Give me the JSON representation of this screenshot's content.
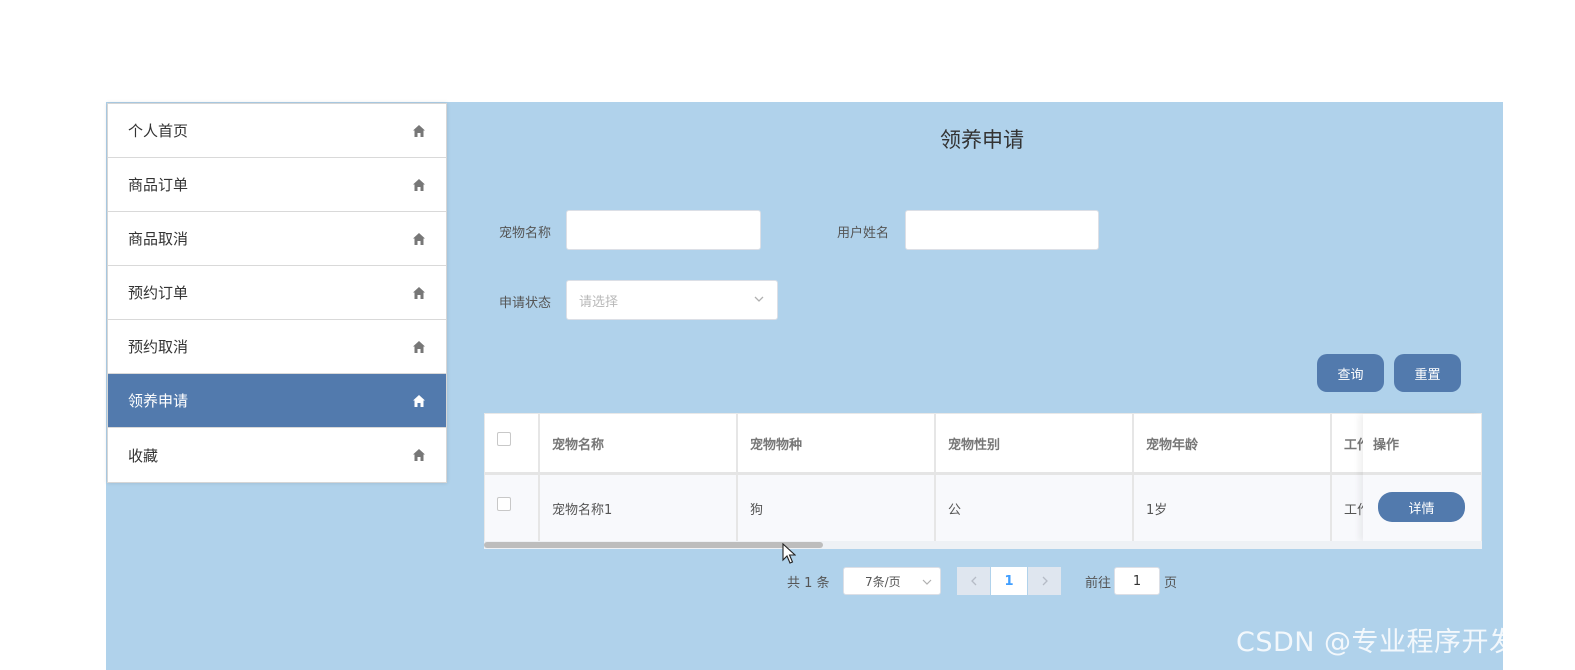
{
  "sidebar": {
    "items": [
      {
        "label": "个人首页",
        "icon": "home-icon",
        "active": false
      },
      {
        "label": "商品订单",
        "icon": "home-icon",
        "active": false
      },
      {
        "label": "商品取消",
        "icon": "home-icon",
        "active": false
      },
      {
        "label": "预约订单",
        "icon": "home-icon",
        "active": false
      },
      {
        "label": "预约取消",
        "icon": "home-icon",
        "active": false
      },
      {
        "label": "领养申请",
        "icon": "home-icon",
        "active": true
      },
      {
        "label": "收藏",
        "icon": "home-icon",
        "active": false
      }
    ]
  },
  "main": {
    "title": "领养申请",
    "search": {
      "pet_name_label": "宠物名称",
      "pet_name_value": "",
      "user_name_label": "用户姓名",
      "user_name_value": "",
      "status_label": "申请状态",
      "status_placeholder": "请选择",
      "query_button": "查询",
      "reset_button": "重置"
    },
    "table": {
      "columns": [
        "宠物名称",
        "宠物物种",
        "宠物性别",
        "宠物年龄",
        "工作"
      ],
      "op_column": "操作",
      "rows": [
        {
          "cells": [
            "宠物名称1",
            "狗",
            "公",
            "1岁",
            "工作"
          ],
          "action": "详情"
        }
      ],
      "scroll_position": 0.34
    },
    "pagination": {
      "total_text": "共 1 条",
      "page_size": "7条/页",
      "current_page": "1",
      "goto_label": "前往",
      "goto_value": "1",
      "page_suffix": "页"
    }
  },
  "watermark": "CSDN @专业程序开发源",
  "colors": {
    "panel_bg": "#b0d2eb",
    "accent": "#527aad",
    "link": "#409eff"
  }
}
